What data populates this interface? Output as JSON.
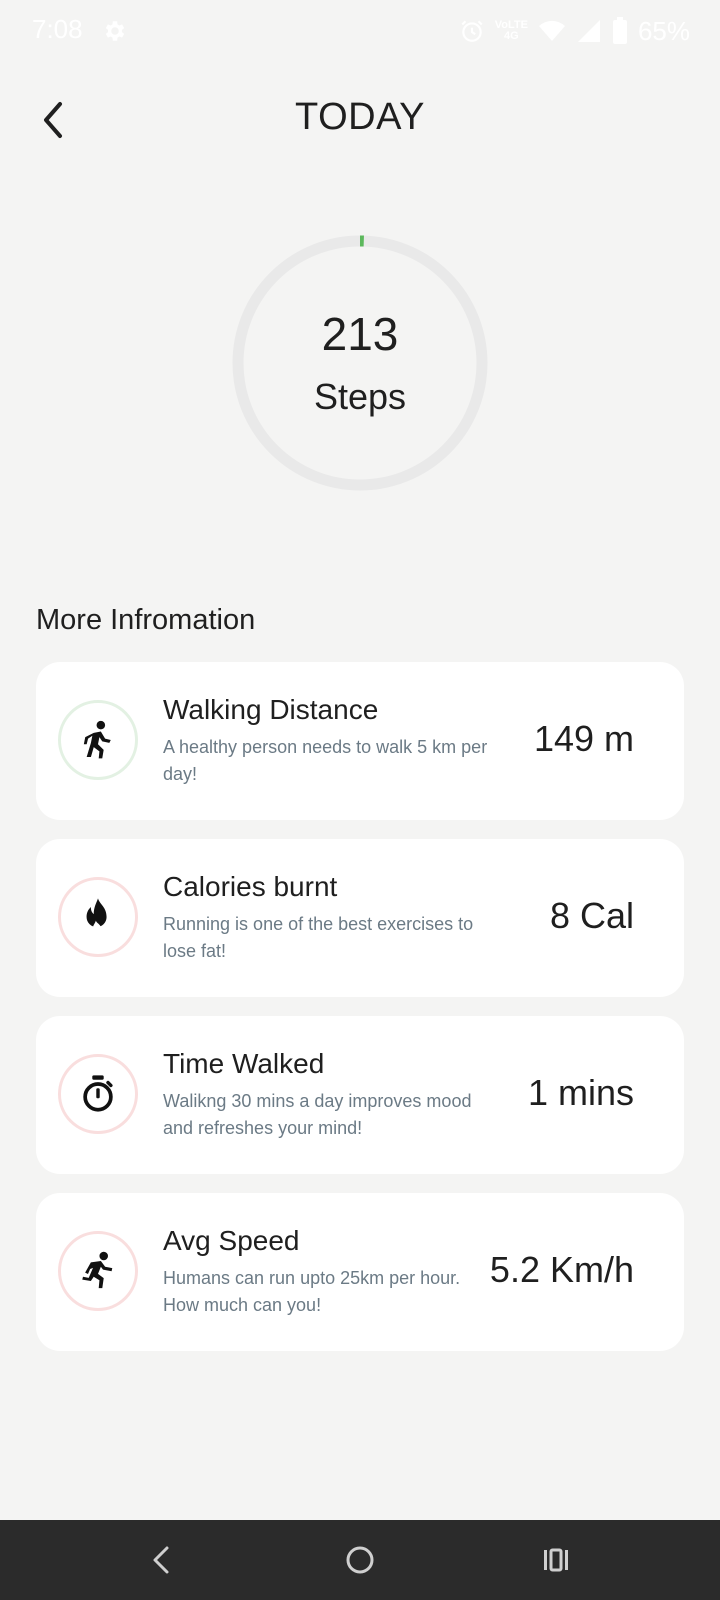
{
  "status_bar": {
    "time": "7:08",
    "battery": "65%",
    "volte_line1": "VoLTE",
    "volte_line2": "4G",
    "icons": [
      "settings-icon",
      "alarm-icon",
      "volte-icon",
      "wifi-icon",
      "signal-icon",
      "battery-icon"
    ]
  },
  "header": {
    "title": "TODAY",
    "back_icon": "chevron-left-icon"
  },
  "steps": {
    "count": "213",
    "unit": "Steps",
    "progress_fraction": 0.01,
    "progress_color": "#5cb85c",
    "track_color": "#e9e9e9"
  },
  "section": {
    "title": "More Infromation"
  },
  "cards": [
    {
      "title": "Walking Distance",
      "desc": "A healthy person needs to walk 5 km per day!",
      "value": "149 m",
      "icon": "walking-person-icon",
      "ring_color": "#e3f1e3"
    },
    {
      "title": "Calories burnt",
      "desc": "Running is one of the best exercises to lose fat!",
      "value": "8 Cal",
      "icon": "flame-icon",
      "ring_color": "#f9dede"
    },
    {
      "title": "Time Walked",
      "desc": "Walikng 30 mins a day improves mood and refreshes your mind!",
      "value": "1 mins",
      "icon": "stopwatch-icon",
      "ring_color": "#f9dede"
    },
    {
      "title": "Avg Speed",
      "desc": "Humans can run upto 25km per hour. How much can you!",
      "value": "5.2 Km/h",
      "icon": "running-person-icon",
      "ring_color": "#f9dede"
    }
  ],
  "nav": {
    "icons": [
      "nav-back-icon",
      "nav-home-icon",
      "nav-recents-icon"
    ]
  }
}
